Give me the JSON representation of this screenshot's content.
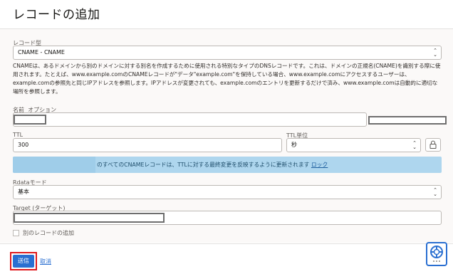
{
  "dialog": {
    "title": "レコードの追加"
  },
  "record_type": {
    "label": "レコード型",
    "value": "CNAME - CNAME"
  },
  "description": "CNAMEは、あるドメインから別のドメインに対する別名を作成するために使用される特別なタイプのDNSレコードです。これは、ドメインの正規名(CNAME)を識別する際に使用されます。たとえば、www.example.comのCNAMEレコードが\"データ\"example.com\"を保持している場合、www.example.comにアクセスするユーザーは、example.comの参照先と同じIPアドレスを参照します。IPアドレスが変更されても、example.comのエントリを更新するだけで済み、www.example.comは自動的に適切な場所を参照します。",
  "name_field": {
    "label": "名前",
    "optional": "オプション"
  },
  "ttl": {
    "label": "TTL",
    "value": "300"
  },
  "ttl_unit": {
    "label": "TTL単位",
    "value": "秒"
  },
  "banner": {
    "text": "のすべてのCNAMEレコードは、TTLに対する最終変更を反映するように更新されます",
    "link": "ロック"
  },
  "rdata_mode": {
    "label": "Rdataモード",
    "value": "基本"
  },
  "target": {
    "label": "Target (ターゲット)"
  },
  "add_another": {
    "label": "別のレコードの追加"
  },
  "footer": {
    "submit": "送信",
    "cancel": "取消"
  },
  "colors": {
    "primary": "#2a6fd1",
    "highlight": "#e0191d",
    "banner": "#aed6ee"
  },
  "icons": [
    "chevron-updown-icon",
    "lock-icon",
    "help-lifebuoy-icon"
  ]
}
